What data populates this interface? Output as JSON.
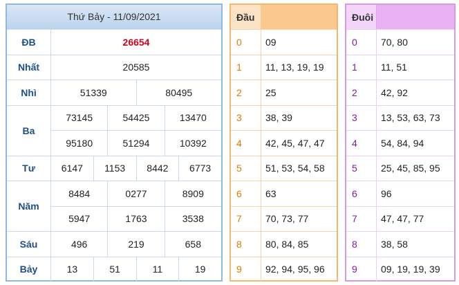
{
  "main": {
    "title": "Thứ Bảy - 11/09/2021",
    "prizes": [
      {
        "label": "ĐB",
        "rows": [
          [
            "26654"
          ]
        ],
        "special": true
      },
      {
        "label": "Nhất",
        "rows": [
          [
            "20585"
          ]
        ]
      },
      {
        "label": "Nhì",
        "rows": [
          [
            "51339",
            "80495"
          ]
        ]
      },
      {
        "label": "Ba",
        "rows": [
          [
            "73145",
            "54425",
            "13470"
          ],
          [
            "95180",
            "51294",
            "10392"
          ]
        ]
      },
      {
        "label": "Tư",
        "rows": [
          [
            "6147",
            "1153",
            "8442",
            "6773"
          ]
        ]
      },
      {
        "label": "Năm",
        "rows": [
          [
            "8484",
            "0277",
            "8909"
          ],
          [
            "5947",
            "1763",
            "3538"
          ]
        ]
      },
      {
        "label": "Sáu",
        "rows": [
          [
            "496",
            "219",
            "658"
          ]
        ]
      },
      {
        "label": "Bảy",
        "rows": [
          [
            "13",
            "51",
            "11",
            "19"
          ]
        ]
      }
    ]
  },
  "dau": {
    "header": "Đầu",
    "rows": [
      {
        "k": "0",
        "v": "09"
      },
      {
        "k": "1",
        "v": "11, 13, 19, 19"
      },
      {
        "k": "2",
        "v": "25"
      },
      {
        "k": "3",
        "v": "38, 39"
      },
      {
        "k": "4",
        "v": "42, 45, 47, 47"
      },
      {
        "k": "5",
        "v": "51, 53, 54, 58"
      },
      {
        "k": "6",
        "v": "63"
      },
      {
        "k": "7",
        "v": "70, 73, 77"
      },
      {
        "k": "8",
        "v": "80, 84, 85"
      },
      {
        "k": "9",
        "v": "92, 94, 95, 96"
      }
    ]
  },
  "duoi": {
    "header": "Đuôi",
    "rows": [
      {
        "k": "0",
        "v": "70, 80"
      },
      {
        "k": "1",
        "v": "11, 51"
      },
      {
        "k": "2",
        "v": "42, 92"
      },
      {
        "k": "3",
        "v": "13, 53, 63, 73"
      },
      {
        "k": "4",
        "v": "54, 84, 94"
      },
      {
        "k": "5",
        "v": "25, 45, 85, 95"
      },
      {
        "k": "6",
        "v": "96"
      },
      {
        "k": "7",
        "v": "47, 47, 77"
      },
      {
        "k": "8",
        "v": "38, 58"
      },
      {
        "k": "9",
        "v": "09, 19, 19, 39"
      }
    ]
  },
  "colors": {
    "special": "#d0021b",
    "label": "#1f4f86",
    "dau_key": "#e07b00",
    "duoi_key": "#7b1f9e"
  }
}
